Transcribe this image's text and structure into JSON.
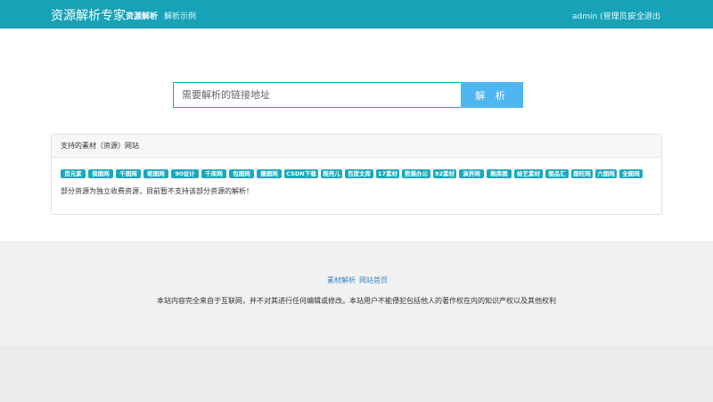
{
  "header": {
    "brand": "资源解析专家",
    "nav": [
      "资源解析",
      "解析示例"
    ],
    "user": "admin (管理员)",
    "logout": "安全退出"
  },
  "search": {
    "placeholder": "需要解析的链接地址",
    "button": "解 析"
  },
  "sites": {
    "title": "支持的素材（资源）网站",
    "tags": [
      "觅元素",
      "我图网",
      "千图网",
      "昵图网",
      "90设计",
      "千库网",
      "包图网",
      "摄图网",
      "CSDN下载",
      "稻壳儿",
      "百度文库",
      "17素材",
      "熊猫办公",
      "92素材",
      "演界网",
      "粮库图",
      "绘艺素材",
      "图品汇",
      "图旺网",
      "六图网",
      "全图网"
    ],
    "note": "部分资源为独立收费资源，目前暂不支持该部分资源的解析！"
  },
  "footer": {
    "links": [
      "素材解析",
      "网站首页"
    ],
    "disclaimer": "本站内容完全来自于互联网，并不对其进行任何编辑或修改。本站用户不能侵犯包括他人的著作权在内的知识产权以及其他权利"
  },
  "colors": {
    "header": "#17a2b8",
    "button": "#4fb6f2",
    "tag": "#1aa8bc",
    "link": "#3a86c8"
  }
}
